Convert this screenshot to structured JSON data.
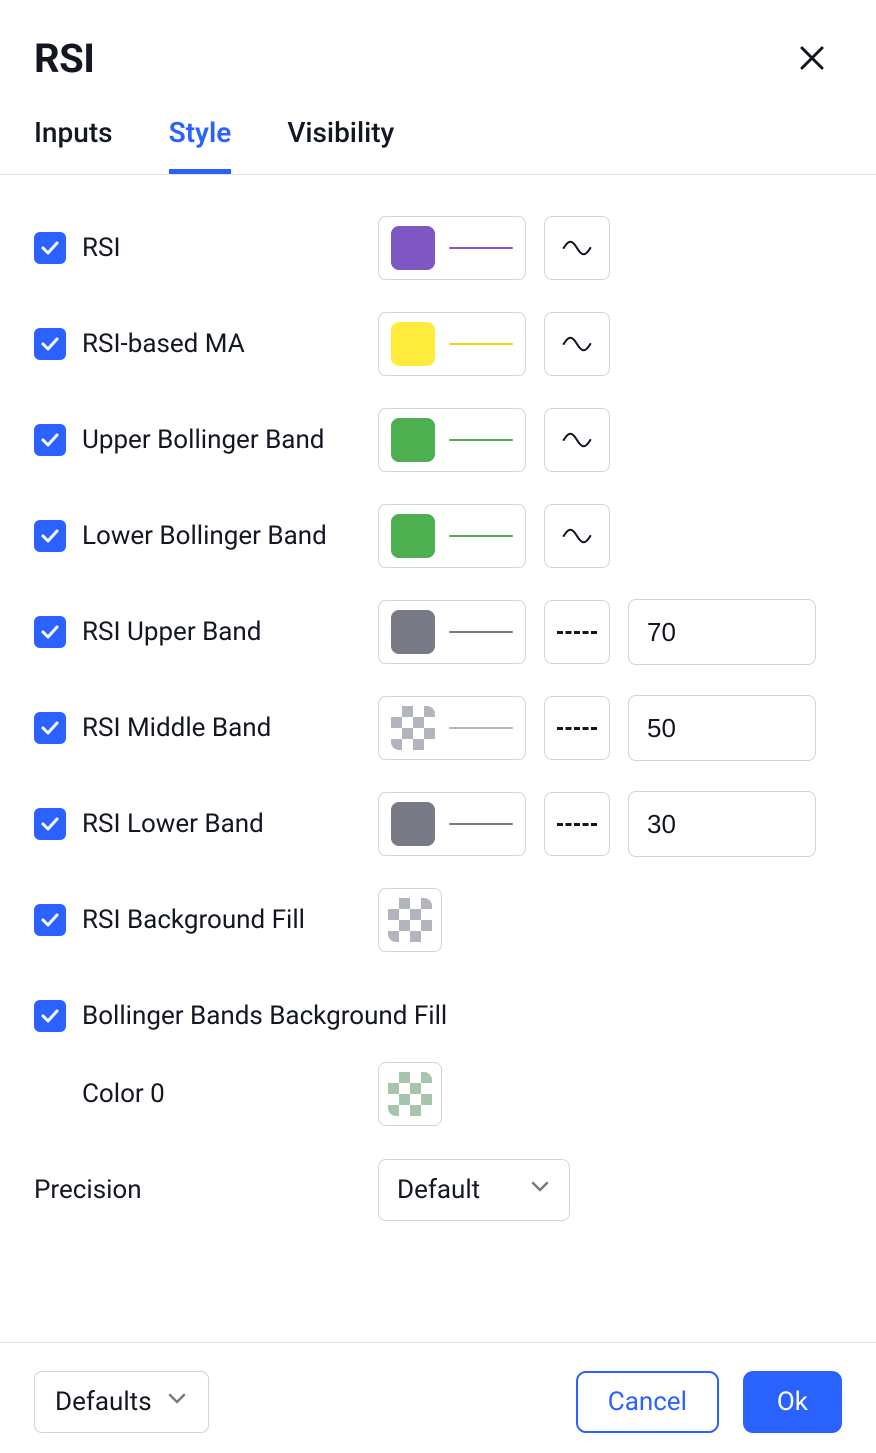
{
  "header": {
    "title": "RSI"
  },
  "tabs": {
    "inputs": "Inputs",
    "style": "Style",
    "visibility": "Visibility",
    "active": "style"
  },
  "rows": {
    "rsi": {
      "label": "RSI",
      "checked": true,
      "color": "#7e57c2",
      "line_color": "#7e57c2"
    },
    "rsi_ma": {
      "label": "RSI-based MA",
      "checked": true,
      "color": "#ffeb3b",
      "line_color": "#f2d40e"
    },
    "upper_bb": {
      "label": "Upper Bollinger Band",
      "checked": true,
      "color": "#4caf50",
      "line_color": "#4caf50"
    },
    "lower_bb": {
      "label": "Lower Bollinger Band",
      "checked": true,
      "color": "#4caf50",
      "line_color": "#4caf50"
    },
    "rsi_upper": {
      "label": "RSI Upper Band",
      "checked": true,
      "color": "#787b86",
      "line_color": "#787b86",
      "value": "70"
    },
    "rsi_middle": {
      "label": "RSI Middle Band",
      "checked": true,
      "checker": "#b2b5be",
      "line_color": "#b2b5be",
      "value": "50"
    },
    "rsi_lower": {
      "label": "RSI Lower Band",
      "checked": true,
      "color": "#787b86",
      "line_color": "#787b86",
      "value": "30"
    },
    "rsi_bg": {
      "label": "RSI Background Fill",
      "checked": true,
      "checker": "#b2b5be"
    },
    "bb_bg": {
      "label": "Bollinger Bands Background Fill",
      "checked": true
    },
    "color0": {
      "label": "Color 0",
      "checker": "#a9c4ad"
    }
  },
  "precision": {
    "label": "Precision",
    "value": "Default"
  },
  "footer": {
    "defaults": "Defaults",
    "cancel": "Cancel",
    "ok": "Ok"
  }
}
